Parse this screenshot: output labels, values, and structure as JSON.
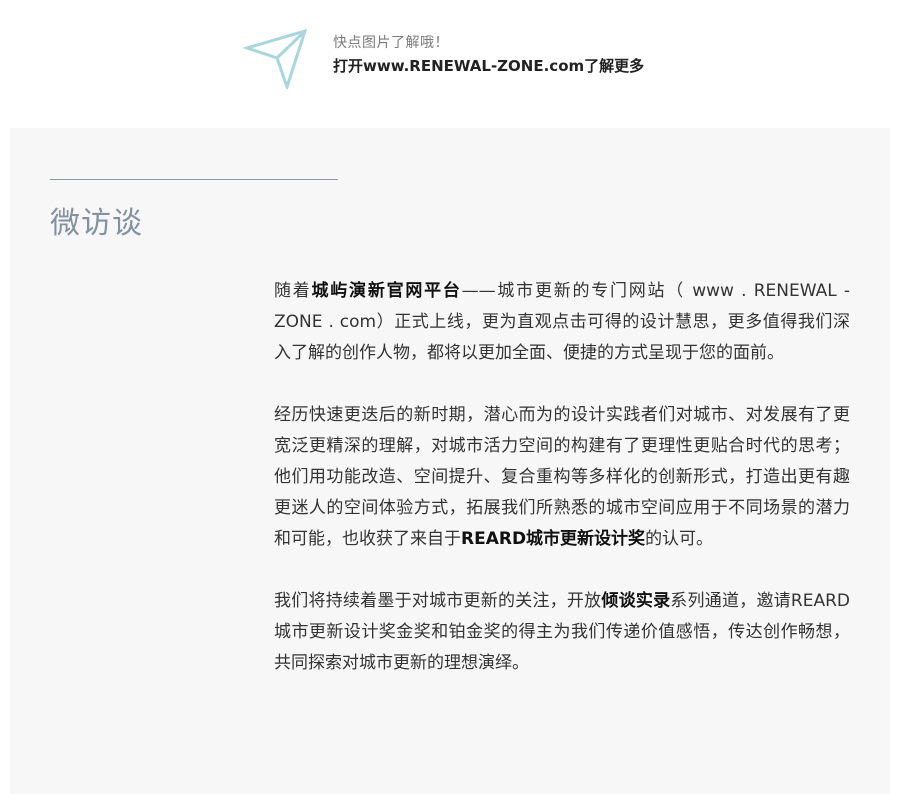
{
  "banner": {
    "icon": "paper-plane-icon",
    "accent_color": "#a8d6dc",
    "line1": "快点图片了解哦！",
    "line2": "打开www.RENEWAL-ZONE.com了解更多"
  },
  "section": {
    "title": "微访谈",
    "title_color": "#8391a1"
  },
  "paragraphs": [
    {
      "p1": "随着",
      "b1": "城屿演新官网平台",
      "p2": "——城市更新的专门网站（ www . RENEWAL - ZONE . com）正式上线，更为直观点击可得的设计慧思，更多值得我们深入了解的创作人物，都将以更加全面、便捷的方式呈现于您的面前。"
    },
    {
      "p1": "经历快速更迭后的新时期，潜心而为的设计实践者们对城市、对发展有了更宽泛更精深的理解，对城市活力空间的构建有了更理性更贴合时代的思考；他们用功能改造、空间提升、复合重构等多样化的创新形式，打造出更有趣更迷人的空间体验方式，拓展我们所熟悉的城市空间应用于不同场景的潜力和可能，也收获了来自于",
      "b1": "REARD城市更新设计奖",
      "p2": "的认可。"
    },
    {
      "p1": "我们将持续着墨于对城市更新的关注，开放",
      "b1": "倾谈实录",
      "p2": "系列通道，邀请REARD城市更新设计奖金奖和铂金奖的得主为我们传递价值感悟，传达创作畅想，共同探索对城市更新的理想演绎。"
    }
  ]
}
